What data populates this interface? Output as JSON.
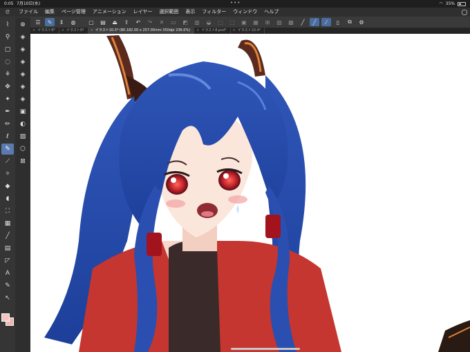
{
  "status": {
    "time": "0:05",
    "date": "7月10日(水)",
    "dots": "•••",
    "battery": "35%",
    "battery_level": 0.35
  },
  "menu": {
    "app_icon": "clip-studio-icon",
    "items": [
      "ファイル",
      "編集",
      "ページ管理",
      "アニメーション",
      "レイヤー",
      "選択範囲",
      "表示",
      "フィルター",
      "ウィンドウ",
      "ヘルプ"
    ]
  },
  "tabs": [
    {
      "label": "イラスト9*",
      "active": false
    },
    {
      "label": "イラスト9*",
      "active": false
    },
    {
      "label": "イラスト10.3* (80.182.00 x 257.00mm 350dpi 236.0%)",
      "active": true
    },
    {
      "label": "イラスト8.psd*",
      "active": false
    },
    {
      "label": "イラスト10.4*",
      "active": false
    }
  ],
  "colors": {
    "fg": "#f3c7c0",
    "bg": "#f2b5ad",
    "accent": "#5b7bb0"
  }
}
